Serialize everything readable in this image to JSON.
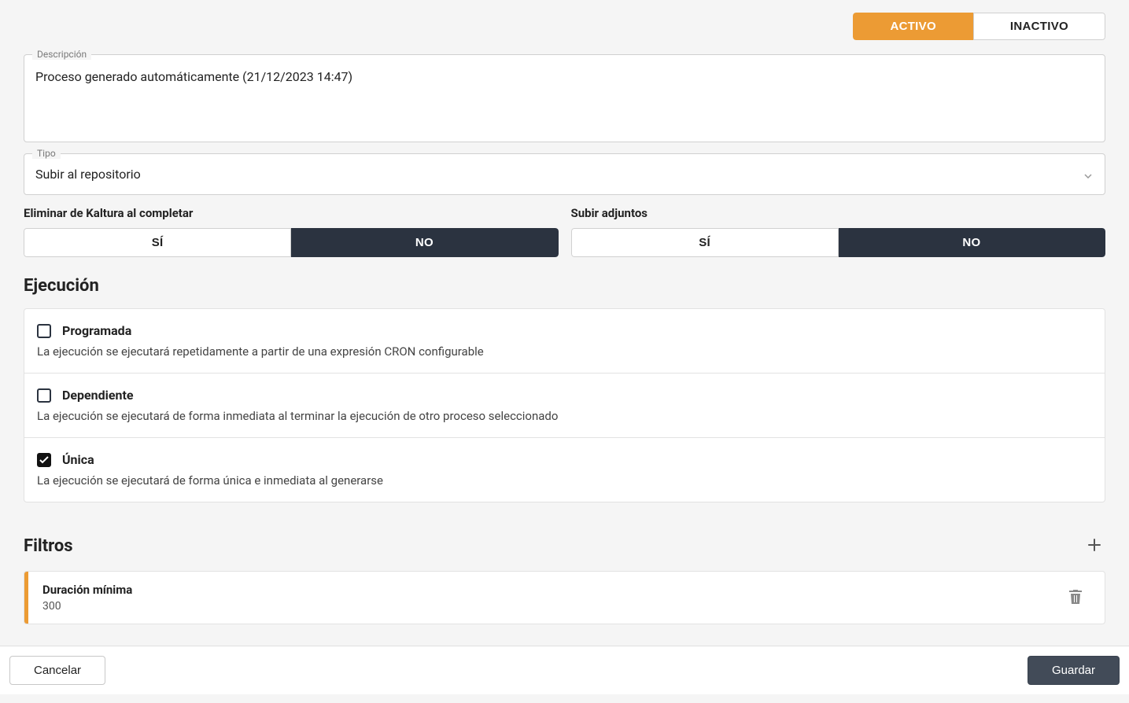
{
  "status": {
    "active_label": "ACTIVO",
    "inactive_label": "INACTIVO",
    "active": true
  },
  "description": {
    "label": "Descripción",
    "value": "Proceso generado automáticamente (21/12/2023 14:47)"
  },
  "type": {
    "label": "Tipo",
    "value": "Subir al repositorio"
  },
  "toggles": {
    "delete_kaltura": {
      "label": "Eliminar de Kaltura al completar",
      "yes": "SÍ",
      "no": "NO",
      "value": "no"
    },
    "upload_attachments": {
      "label": "Subir adjuntos",
      "yes": "SÍ",
      "no": "NO",
      "value": "no"
    }
  },
  "execution": {
    "heading": "Ejecución",
    "options": [
      {
        "title": "Programada",
        "desc": "La ejecución se ejecutará repetidamente a partir de una expresión CRON configurable",
        "checked": false
      },
      {
        "title": "Dependiente",
        "desc": "La ejecución se ejecutará de forma inmediata al terminar la ejecución de otro proceso seleccionado",
        "checked": false
      },
      {
        "title": "Única",
        "desc": "La ejecución se ejecutará de forma única e inmediata al generarse",
        "checked": true
      }
    ]
  },
  "filters": {
    "heading": "Filtros",
    "items": [
      {
        "title": "Duración mínima",
        "value": "300"
      }
    ]
  },
  "footer": {
    "cancel": "Cancelar",
    "save": "Guardar"
  }
}
